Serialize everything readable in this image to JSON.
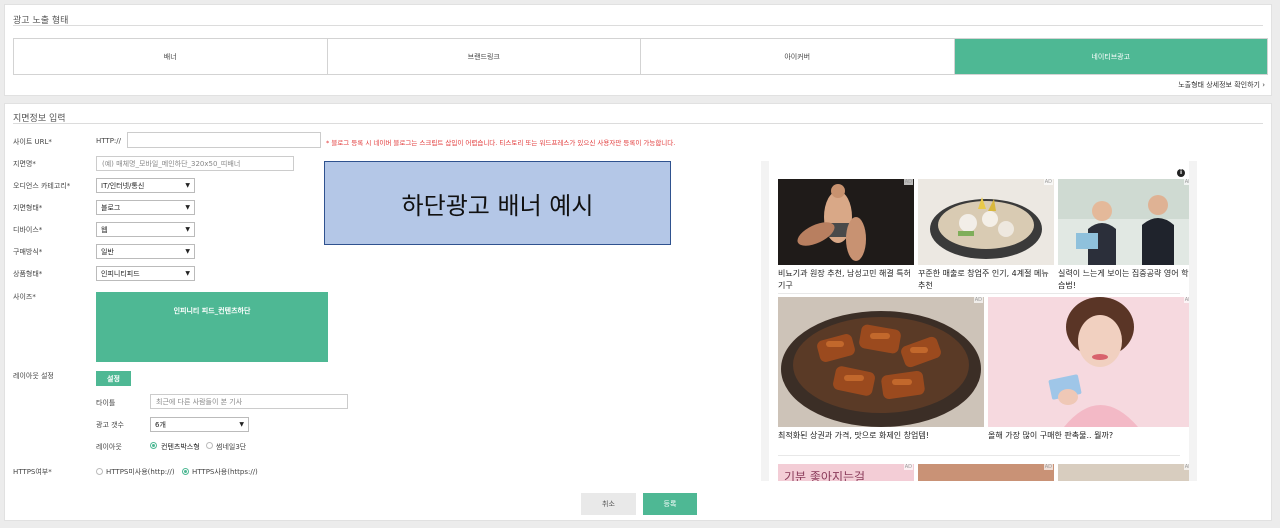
{
  "top": {
    "title": "광고 노출 형태",
    "tabs": [
      {
        "label": "배너",
        "active": false
      },
      {
        "label": "브랜드링크",
        "active": false
      },
      {
        "label": "아이커버",
        "active": false
      },
      {
        "label": "네이티브광고",
        "active": true
      }
    ],
    "detail_link": "노출형태 상세정보 확인하기 ›"
  },
  "form": {
    "title": "지면정보 입력",
    "site_url": {
      "label": "사이트 URL*",
      "prefix": "HTTP://",
      "value": "",
      "warning": "* 블로그 등록 시 네이버 블로그는 스크립트 삽입이 어렵습니다. 티스토리 또는 워드프레스가 있으신 사용자만 등록이 가능합니다."
    },
    "placement_name": {
      "label": "지면명*",
      "placeholder": "(예) 매체명_모바일_메인하단_320x50_띠배너"
    },
    "audience": {
      "label": "오디언스 카테고리*",
      "value": "IT/인터넷/통신"
    },
    "placement_type": {
      "label": "지면형태*",
      "value": "블로그"
    },
    "device": {
      "label": "디바이스*",
      "value": "웹"
    },
    "purchase": {
      "label": "구매방식*",
      "value": "일반"
    },
    "product": {
      "label": "상품형태*",
      "value": "인피니티피드"
    },
    "size": {
      "label": "사이즈*",
      "value": "인피니티 피드_컨텐츠하단"
    },
    "layout": {
      "label": "레이아웃 설정",
      "button": "설정",
      "title_label": "타이틀",
      "title_placeholder": "최근에 다른 사람들이 본 기사",
      "count_label": "광고 갯수",
      "count_value": "6개",
      "layout_label": "레이아웃",
      "options": [
        "컨텐츠박스형",
        "썸네일3단"
      ],
      "selected": 0
    },
    "https": {
      "label": "HTTPS여부*",
      "options": [
        "HTTPS미사용(http://)",
        "HTTPS사용(https://)"
      ],
      "selected": 1
    },
    "cancel": "취소",
    "submit": "등록"
  },
  "banner_example": "하단광고 배너 예시",
  "preview": {
    "ad_badge": "AD",
    "info_icon": "i",
    "row1": [
      {
        "caption": "비뇨기과 원장 추천, 남성고민 해결 특허기구",
        "icon": "couple-photo"
      },
      {
        "caption": "꾸준한 매출로 창업주 인기, 4계절 메뉴 추천",
        "icon": "hotpot-photo"
      },
      {
        "caption": "실력이 느는게 보이는 집중공략 영어 학습법!",
        "icon": "businessmen-photo"
      }
    ],
    "row2": [
      {
        "caption": "최적화된 상권과 가격, 맛으로 화제인 창업템!",
        "icon": "grilled-meat-photo"
      },
      {
        "caption": "올해 가장 많이 구매한 판촉물.. 뭘까?",
        "icon": "woman-card-photo"
      }
    ],
    "row3_text": "기분 좋아지는걸"
  }
}
